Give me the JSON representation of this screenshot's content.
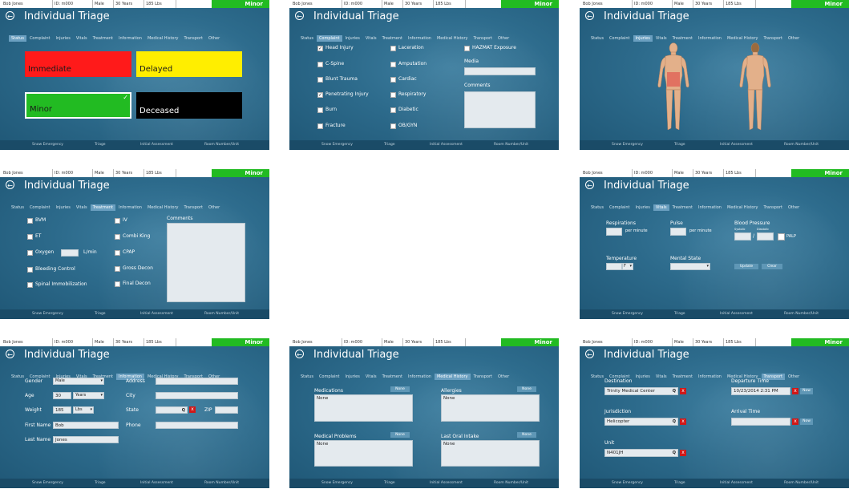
{
  "app_title": "Individual Triage",
  "header": {
    "name": "Bob Jones",
    "id": "ID: m000",
    "sex": "Male",
    "age": "30 Years",
    "weight": "185 Lbs",
    "status": "Minor"
  },
  "tabs": [
    "Status",
    "Complaint",
    "Injuries",
    "Vitals",
    "Treatment",
    "Information",
    "Medical History",
    "Transport",
    "Other"
  ],
  "footer": {
    "incident": "Snow Emergency",
    "position": "Triage",
    "division": "Initial Assessment",
    "unit": "Room Number/Unit"
  },
  "status_panel": {
    "tiles": [
      {
        "label": "Immediate",
        "color": "#ff1a1a",
        "text_color": "#1a1a1a"
      },
      {
        "label": "Delayed",
        "color": "#ffee00",
        "text_color": "#1a1a1a"
      },
      {
        "label": "Minor",
        "color": "#22bb22",
        "text_color": "#1a1a1a",
        "selected": true,
        "check": "✓"
      },
      {
        "label": "Deceased",
        "color": "#000000",
        "text_color": "#ffffff"
      }
    ]
  },
  "complaint_panel": {
    "col1": [
      {
        "label": "Head Injury",
        "checked": true
      },
      {
        "label": "C-Spine",
        "checked": false
      },
      {
        "label": "Blunt Trauma",
        "checked": false
      },
      {
        "label": "Penetrating Injury",
        "checked": true
      },
      {
        "label": "Burn",
        "checked": false
      },
      {
        "label": "Fracture",
        "checked": false
      }
    ],
    "col2": [
      {
        "label": "Laceration",
        "checked": false
      },
      {
        "label": "Amputation",
        "checked": false
      },
      {
        "label": "Cardiac",
        "checked": false
      },
      {
        "label": "Respiratory",
        "checked": false
      },
      {
        "label": "Diabetic",
        "checked": false
      },
      {
        "label": "OB/GYN",
        "checked": false
      }
    ],
    "hazmat": "HAZMAT Exposure",
    "media_label": "Media",
    "comments_label": "Comments"
  },
  "treatment_panel": {
    "col1": [
      "BVM",
      "ET",
      "Oxygen",
      "Bleeding Control",
      "Spinal Immobilization"
    ],
    "oxygen_unit": "L/min",
    "col2": [
      "IV",
      "Combi King",
      "CPAP",
      "Gross Decon",
      "Final Decon"
    ],
    "comments_label": "Comments"
  },
  "vitals_panel": {
    "respirations_label": "Respirations",
    "respirations_unit": "per minute",
    "pulse_label": "Pulse",
    "pulse_unit": "per minute",
    "bp_label": "Blood Pressure",
    "systolic_label": "Systolic",
    "diastolic_label": "Diastolic",
    "bp_sep": "/",
    "palp_label": "PALP",
    "temperature_label": "Temperature",
    "temperature_unit": "F",
    "mental_state_label": "Mental State",
    "update_button": "Update",
    "clear_button": "Clear"
  },
  "information_panel": {
    "gender_label": "Gender",
    "gender_value": "Male",
    "age_label": "Age",
    "age_value": "30",
    "age_unit": "Years",
    "weight_label": "Weight",
    "weight_value": "185",
    "weight_unit": "Lbs",
    "first_name_label": "First Name",
    "first_name_value": "Bob",
    "last_name_label": "Last Name",
    "last_name_value": "Jones",
    "address_label": "Address",
    "city_label": "City",
    "state_label": "State",
    "zip_label": "ZIP",
    "phone_label": "Phone",
    "search_glyph": "Q",
    "x_glyph": "x"
  },
  "history_panel": {
    "medications_label": "Medications",
    "medications_value": "None",
    "allergies_label": "Allergies",
    "allergies_value": "None",
    "problems_label": "Medical Problems",
    "problems_value": "None",
    "oral_label": "Last Oral Intake",
    "oral_value": "None",
    "none_button": "None"
  },
  "transport_panel": {
    "destination_label": "Destination",
    "destination_value": "Trinity Medical Center",
    "departure_label": "Departure Time",
    "departure_value": "10/23/2014 2:31 PM",
    "jurisdiction_label": "Jurisdiction",
    "jurisdiction_value": "Helicopter",
    "arrival_label": "Arrival Time",
    "unit_label": "Unit",
    "unit_value": "N401JH",
    "now_button": "Now",
    "search_glyph": "Q",
    "x_glyph": "x"
  }
}
